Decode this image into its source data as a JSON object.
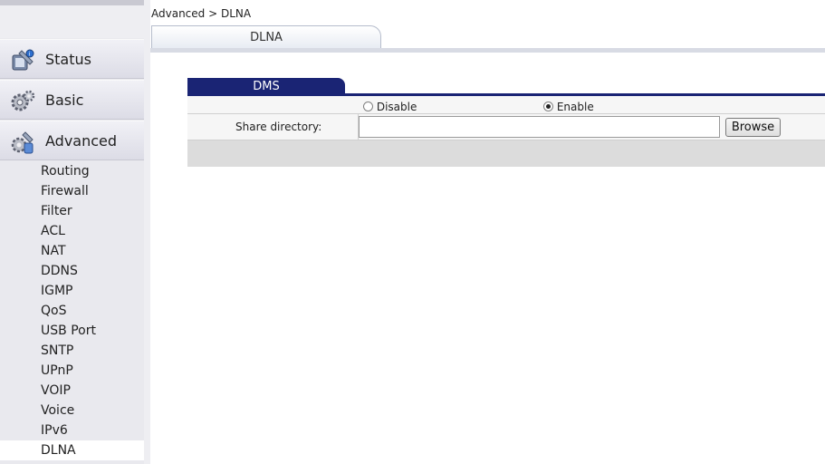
{
  "sidebar": {
    "menus": [
      {
        "label": "Status",
        "icon": "status-icon"
      },
      {
        "label": "Basic",
        "icon": "gear-icon"
      },
      {
        "label": "Advanced",
        "icon": "advanced-tools-icon"
      }
    ],
    "submenu": [
      "Routing",
      "Firewall",
      "Filter",
      "ACL",
      "NAT",
      "DDNS",
      "IGMP",
      "QoS",
      "USB Port",
      "SNTP",
      "UPnP",
      "VOIP",
      "Voice",
      "IPv6",
      "DLNA"
    ],
    "active_item": "DLNA"
  },
  "breadcrumb": "Advanced > DLNA",
  "page_tab": "DLNA",
  "panel": {
    "tab_label": "DMS",
    "radio_disable_label": "Disable",
    "radio_enable_label": "Enable",
    "selected": "Enable",
    "share_label": "Share directory:",
    "share_value": "",
    "browse_label": "Browse"
  },
  "colors": {
    "panel_accent": "#1a2474",
    "sidebar_bg": "#e9e9ee"
  }
}
